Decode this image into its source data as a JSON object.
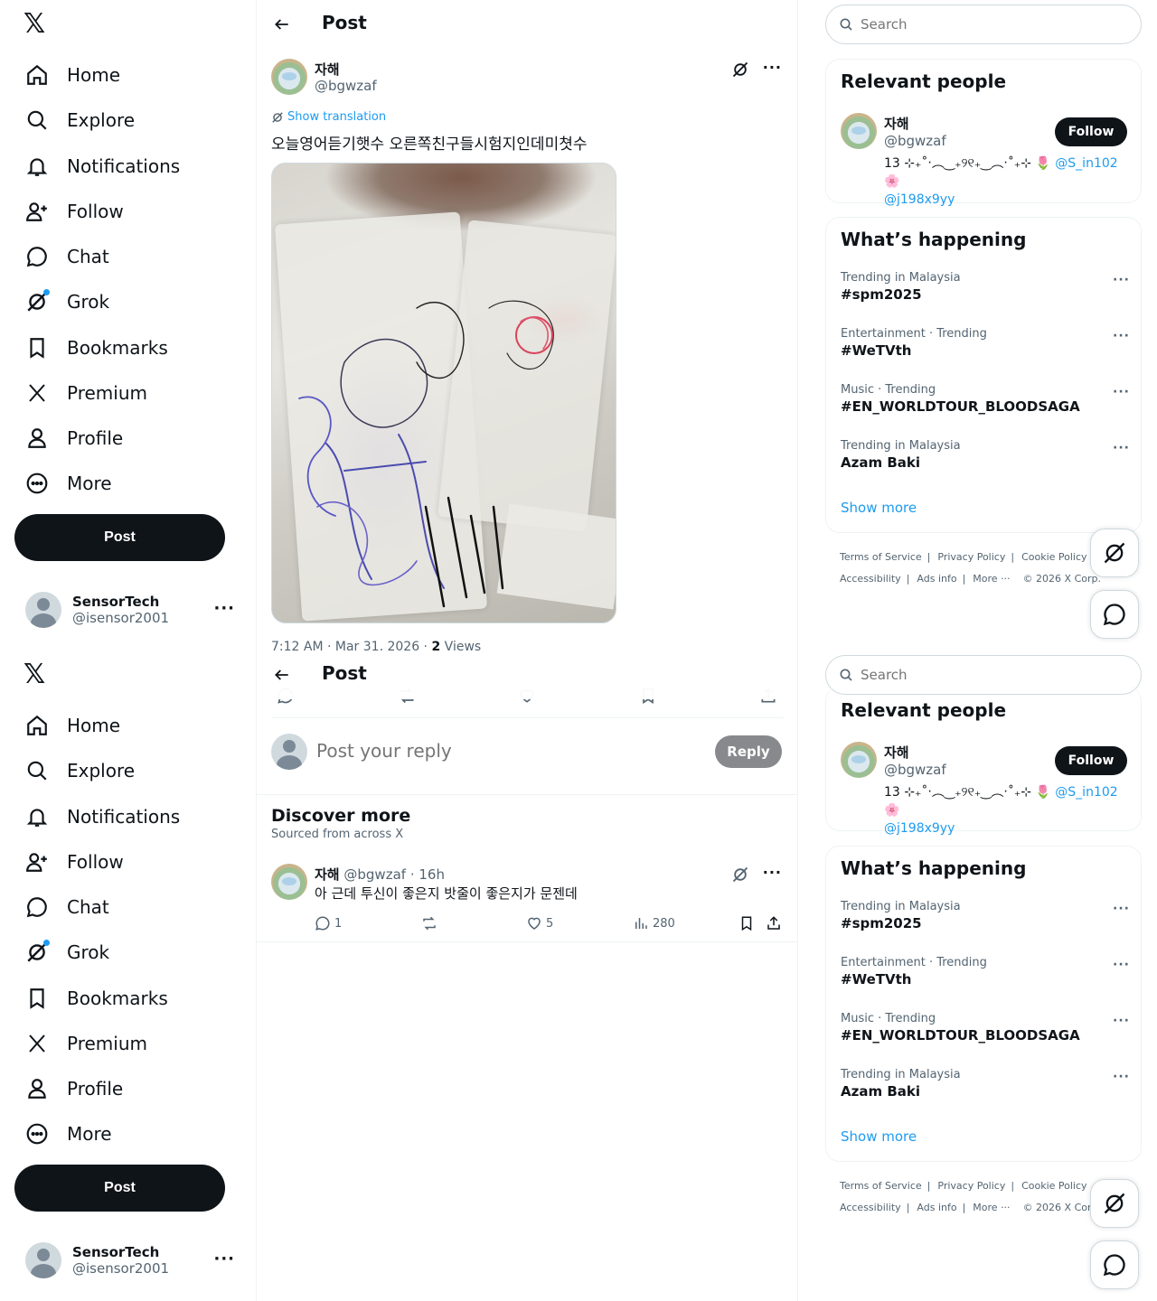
{
  "nav": {
    "items": [
      {
        "label": "Home",
        "icon": "home-icon"
      },
      {
        "label": "Explore",
        "icon": "search-icon"
      },
      {
        "label": "Notifications",
        "icon": "bell-icon"
      },
      {
        "label": "Follow",
        "icon": "add-person-icon"
      },
      {
        "label": "Chat",
        "icon": "chat-bubble-icon"
      },
      {
        "label": "Grok",
        "icon": "grok-icon"
      },
      {
        "label": "Bookmarks",
        "icon": "bookmark-icon"
      },
      {
        "label": "Premium",
        "icon": "x-logo-icon"
      },
      {
        "label": "Profile",
        "icon": "person-icon"
      },
      {
        "label": "More",
        "icon": "more-circle-icon"
      }
    ],
    "post_label": "Post"
  },
  "account": {
    "name": "SensorTech",
    "handle": "@isensor2001"
  },
  "header": {
    "title": "Post"
  },
  "post": {
    "author_name": "자해",
    "author_handle": "@bgwzaf",
    "show_translation": "Show translation",
    "text": "오늘영어듣기햇수 오른쪽친구들시험지인데미쳣수",
    "meta_time": "7:12 AM · Mar 31, 2026 · ",
    "meta_views_count": "2",
    "meta_views_label": " Views"
  },
  "reply": {
    "placeholder": "Post your reply",
    "button": "Reply"
  },
  "discover": {
    "title": "Discover more",
    "subtitle": "Sourced from across X",
    "tweet": {
      "name": "자해",
      "handle": "@bgwzaf",
      "time": " · 16h",
      "text": "아 근데 투신이 좋은지 밧줄이 좋은지가 문젠데",
      "replies": "1",
      "likes": "5",
      "views": "280"
    }
  },
  "search": {
    "placeholder": "Search"
  },
  "relevant": {
    "title": "Relevant people",
    "name": "자해",
    "handle": "@bgwzaf",
    "follow": "Follow",
    "bio_prefix": "13 ⊹₊˚‧︵‿₊୨୧₊‿︵‧˚₊⊹ 🌷 ",
    "bio_link1": "@S_in102",
    "bio_mid": " 🌸",
    "bio_link2": "@j198x9yy"
  },
  "happening": {
    "title": "What’s happening",
    "trends": [
      {
        "context": "Trending in Malaysia",
        "name": "#spm2025"
      },
      {
        "context": "Entertainment · Trending",
        "name": "#WeTVth"
      },
      {
        "context": "Music · Trending",
        "name": "#EN_WORLDTOUR_BLOODSAGA"
      },
      {
        "context": "Trending in Malaysia",
        "name": "Azam Baki"
      }
    ],
    "show_more": "Show more"
  },
  "footer": {
    "links": [
      "Terms of Service",
      "Privacy Policy",
      "Cookie Policy",
      "Accessibility",
      "Ads info",
      "More ···"
    ],
    "copyright": "© 2026 X Corp."
  },
  "colors": {
    "accent": "#1d9bf0",
    "text": "#0f1419",
    "muted": "#536471"
  }
}
